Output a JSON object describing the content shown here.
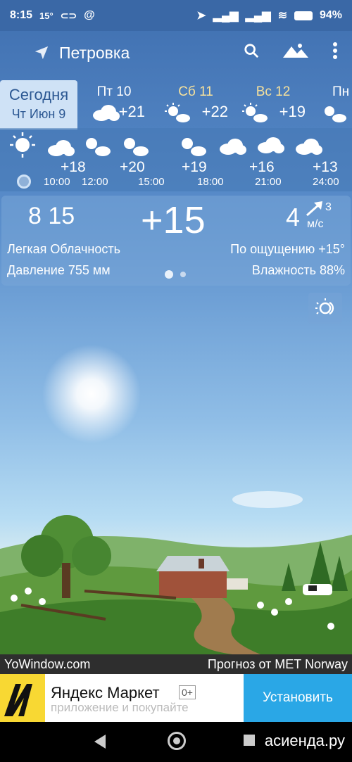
{
  "status": {
    "time": "8:15",
    "temp": "15°",
    "battery": "94%"
  },
  "app": {
    "city": "Петровка"
  },
  "days": [
    {
      "name": "Сегодня",
      "date": "Чт Июн 9"
    },
    {
      "name": "Пт 10",
      "temp": "+21"
    },
    {
      "name": "Сб 11",
      "temp": "+22"
    },
    {
      "name": "Вс 12",
      "temp": "+19"
    },
    {
      "name": "Пн"
    }
  ],
  "hourly": {
    "temps": [
      "+18",
      "+20",
      "+19",
      "+16",
      "+13"
    ],
    "times": [
      "10:00",
      "12:00",
      "15:00",
      "18:00",
      "21:00",
      "24:00"
    ]
  },
  "current": {
    "time": "8 15",
    "temp": "+15",
    "wind_speed": "4",
    "wind_gust": "3",
    "wind_unit": "м/с",
    "description": "Легкая Облачность",
    "feels_like": "По ощущению +15°",
    "pressure": "Давление 755 мм",
    "humidity": "Влажность 88%"
  },
  "footer": {
    "left": "YoWindow.com",
    "right": "Прогноз от MET Norway"
  },
  "ad": {
    "title": "Яндекс Маркет",
    "age": "0+",
    "subtitle": "приложение и покупайте",
    "button": "Установить"
  },
  "watermark": "асиенда.ру",
  "colors": {
    "accent_today": "#cfe2f6",
    "weekend": "#f6e19c",
    "install_button": "#2aa7e6"
  }
}
